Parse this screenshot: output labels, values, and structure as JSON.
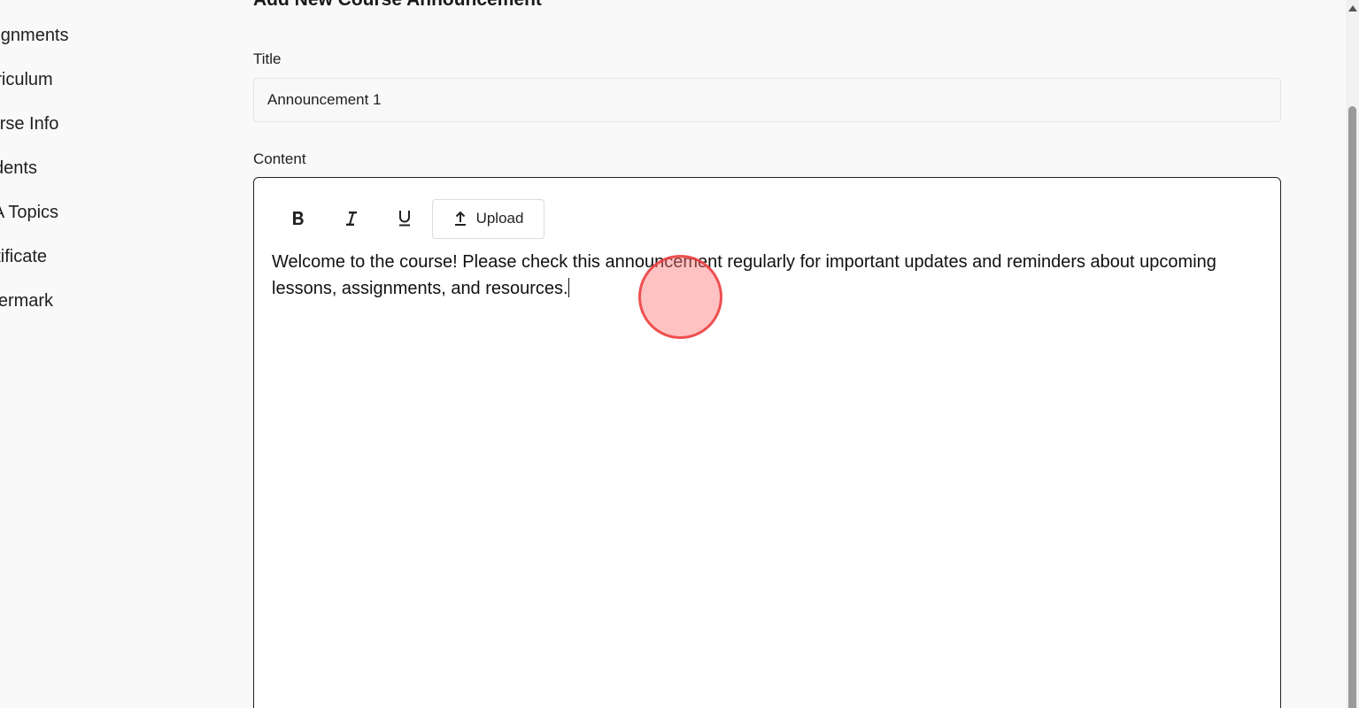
{
  "sidebar": {
    "items": [
      {
        "label": "Assignments",
        "visible_text": "signments"
      },
      {
        "label": "Curriculum",
        "visible_text": "rriculum"
      },
      {
        "label": "Course Info",
        "visible_text": "urse Info"
      },
      {
        "label": "Students",
        "visible_text": "udents"
      },
      {
        "label": "Q&A Topics",
        "visible_text": "&A Topics"
      },
      {
        "label": "Certificate",
        "visible_text": "ertificate"
      },
      {
        "label": "Watermark",
        "visible_text": "atermark"
      }
    ]
  },
  "form": {
    "heading": "Add New Course Announcement",
    "title_label": "Title",
    "title_value": "Announcement 1",
    "content_label": "Content",
    "editor": {
      "toolbar": {
        "bold_icon": "bold-icon",
        "italic_icon": "italic-icon",
        "underline_icon": "underline-icon",
        "upload_icon": "upload-icon",
        "upload_label": "Upload"
      },
      "text": "Welcome to the course! Please check this announcement regularly for important updates and reminders about upcoming lessons, assignments, and resources."
    }
  },
  "colors": {
    "page_bg": "#f9f9f9",
    "editor_border": "#222222",
    "click_indicator": "#eb3c3c"
  }
}
